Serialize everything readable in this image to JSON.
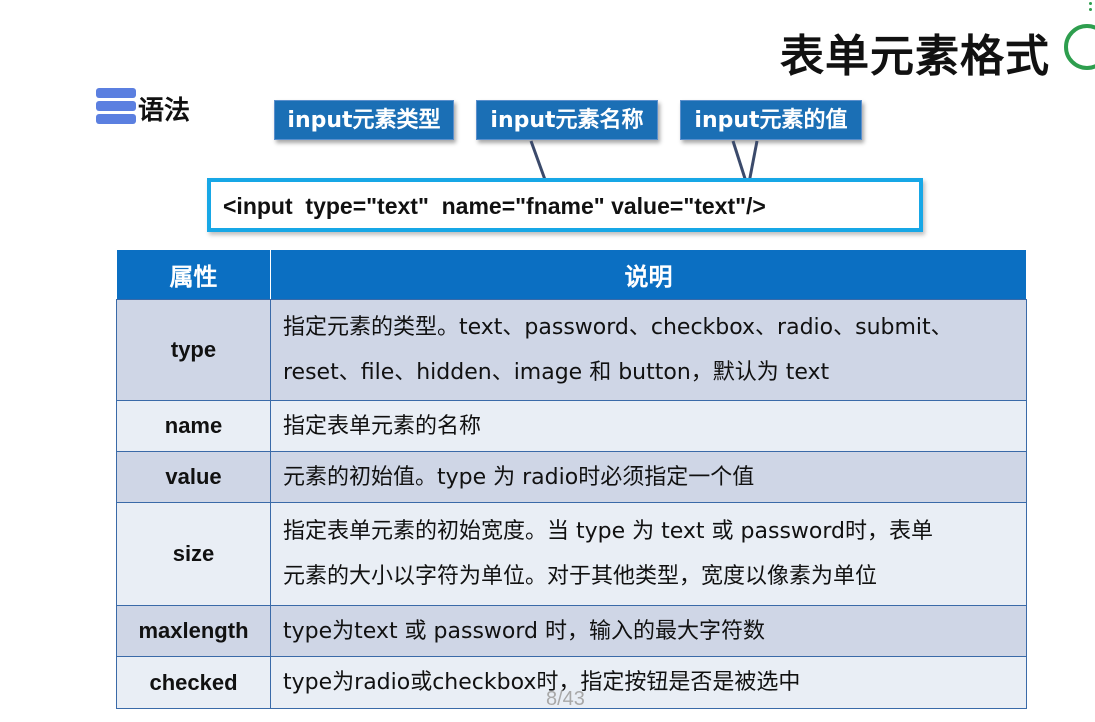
{
  "slide": {
    "title": "表单元素格式",
    "page_number": "8/43"
  },
  "syntax": {
    "label": "语法",
    "callouts": [
      "input元素类型",
      "input元素名称",
      "input元素的值"
    ],
    "code": "<input  type=\"text\"  name=\"fname\" value=\"text\"/>"
  },
  "table": {
    "headers": [
      "属性",
      "说明"
    ],
    "rows": [
      {
        "attribute": "type",
        "lines": [
          "指定元素的类型。text、password、checkbox、radio、submit、",
          "reset、file、hidden、image 和 button，默认为 text"
        ]
      },
      {
        "attribute": "name",
        "lines": [
          "指定表单元素的名称"
        ]
      },
      {
        "attribute": "value",
        "lines": [
          "元素的初始值。type 为 radio时必须指定一个值"
        ]
      },
      {
        "attribute": "size",
        "lines": [
          "指定表单元素的初始宽度。当 type 为 text 或 password时，表单",
          "元素的大小以字符为单位。对于其他类型，宽度以像素为单位"
        ]
      },
      {
        "attribute": "maxlength",
        "lines": [
          "type为text 或 password 时，输入的最大字符数"
        ]
      },
      {
        "attribute": "checked",
        "lines": [
          "type为radio或checkbox时，指定按钮是否是被选中"
        ]
      }
    ]
  },
  "colors": {
    "header_blue": "#0b6fc2",
    "callout_blue": "#1b6fb5",
    "code_border": "#17a7e6",
    "row_dark": "#cfd6e6",
    "row_light": "#e9eef5",
    "accent_green": "#2e9e4e"
  },
  "icons": [
    "stacked-bars-icon",
    "green-ring-icon"
  ]
}
